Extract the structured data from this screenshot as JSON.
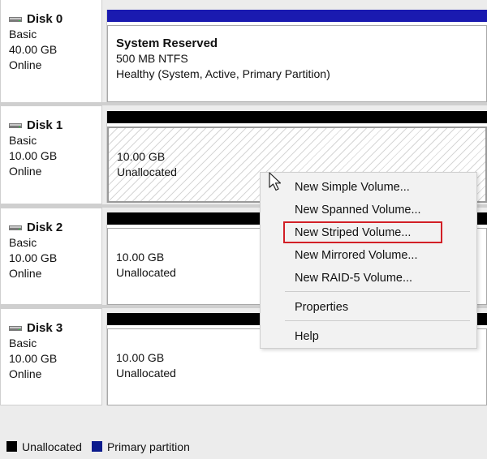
{
  "disks": [
    {
      "name": "Disk 0",
      "type": "Basic",
      "size": "40.00 GB",
      "status": "Online",
      "volume": {
        "title": "System Reserved",
        "line1": "500 MB NTFS",
        "line2": "Healthy (System, Active, Primary Partition)",
        "bar_color": "#1a1ab0"
      }
    },
    {
      "name": "Disk 1",
      "type": "Basic",
      "size": "10.00 GB",
      "status": "Online",
      "volume": {
        "line1": "10.00 GB",
        "line2": "Unallocated",
        "bar_color": "#000000"
      }
    },
    {
      "name": "Disk 2",
      "type": "Basic",
      "size": "10.00 GB",
      "status": "Online",
      "volume": {
        "line1": "10.00 GB",
        "line2": "Unallocated",
        "bar_color": "#000000"
      }
    },
    {
      "name": "Disk 3",
      "type": "Basic",
      "size": "10.00 GB",
      "status": "Online",
      "volume": {
        "line1": "10.00 GB",
        "line2": "Unallocated",
        "bar_color": "#000000"
      }
    }
  ],
  "context_menu": {
    "items": [
      "New Simple Volume...",
      "New Spanned Volume...",
      "New Striped Volume...",
      "New Mirrored Volume...",
      "New RAID-5 Volume...",
      "Properties",
      "Help"
    ],
    "highlighted": "New Striped Volume...",
    "highlight_color": "#d21f26"
  },
  "legend": [
    {
      "label": "Unallocated",
      "color": "#000000"
    },
    {
      "label": "Primary partition",
      "color": "#0a1a8c"
    }
  ],
  "icons": {
    "disk": "disk-drive-icon",
    "cursor": "mouse-pointer-icon"
  }
}
